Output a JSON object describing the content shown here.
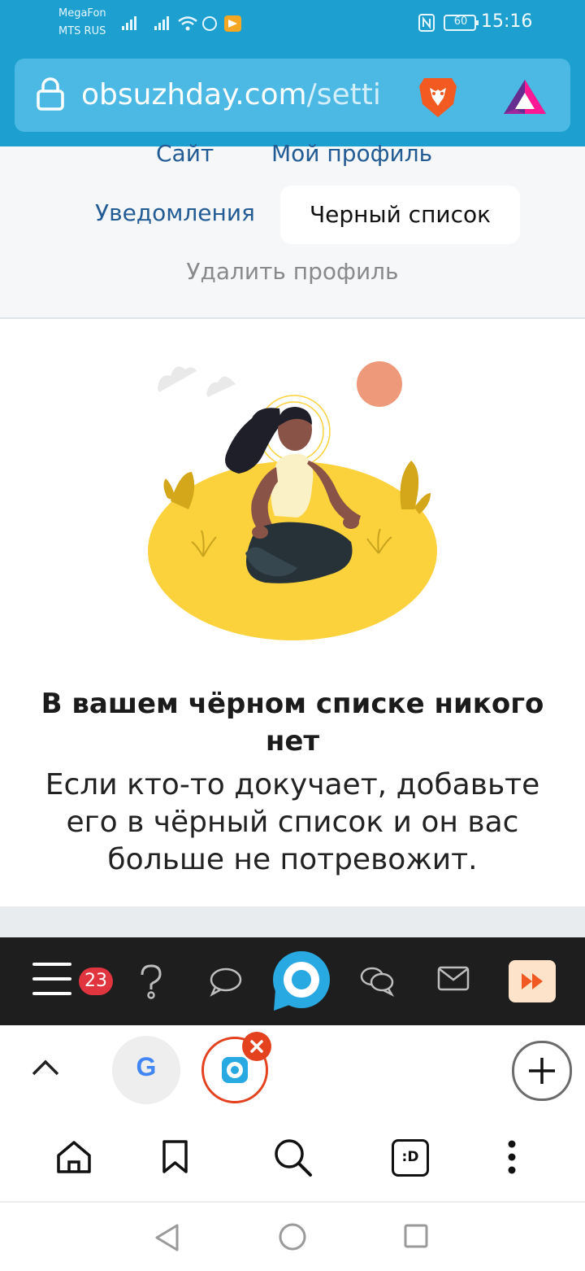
{
  "status_bar": {
    "carrier1": "MegaFon",
    "carrier2": "MTS RUS",
    "battery": "60",
    "time": "15:16"
  },
  "url_bar": {
    "host": "obsuzhday.com",
    "path": "/setti"
  },
  "settings_nav": {
    "site": "Сайт",
    "my_profile": "Мой профиль",
    "notifications": "Уведомления",
    "blacklist": "Черный список",
    "delete_profile": "Удалить профиль"
  },
  "empty_state": {
    "heading": "В вашем чёрном списке никого нет",
    "message": "Если кто-то докучает, добавьте его в чёрный список и он вас больше не потревожит."
  },
  "site_bar": {
    "notification_count": "23"
  },
  "browser_tabs": {
    "google_letter": "G"
  },
  "colors": {
    "header_blue": "#1d9fd0",
    "link_blue": "#235c95",
    "yellow": "#fcd23c",
    "sun": "#ee9a7a",
    "badge_red": "#e0343f",
    "brave_orange": "#e4421e"
  }
}
